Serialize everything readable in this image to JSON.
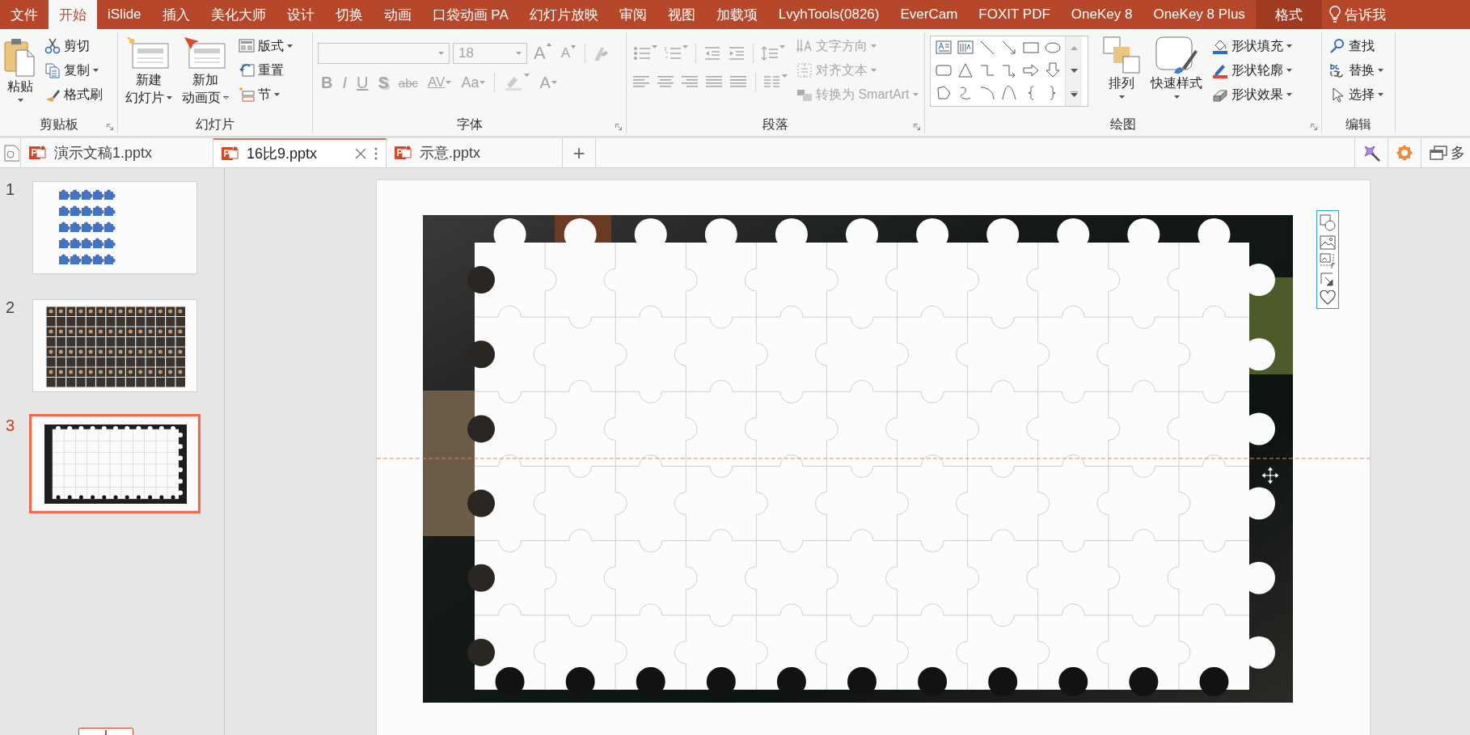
{
  "ribbon_tabs": [
    {
      "label": "文件",
      "selected": false,
      "kind": "normal"
    },
    {
      "label": "开始",
      "selected": true,
      "kind": "normal"
    },
    {
      "label": "iSlide",
      "selected": false,
      "kind": "normal"
    },
    {
      "label": "插入",
      "selected": false,
      "kind": "normal"
    },
    {
      "label": "美化大师",
      "selected": false,
      "kind": "normal"
    },
    {
      "label": "设计",
      "selected": false,
      "kind": "normal"
    },
    {
      "label": "切换",
      "selected": false,
      "kind": "normal"
    },
    {
      "label": "动画",
      "selected": false,
      "kind": "normal"
    },
    {
      "label": "口袋动画 PA",
      "selected": false,
      "kind": "normal"
    },
    {
      "label": "幻灯片放映",
      "selected": false,
      "kind": "normal"
    },
    {
      "label": "审阅",
      "selected": false,
      "kind": "normal"
    },
    {
      "label": "视图",
      "selected": false,
      "kind": "normal"
    },
    {
      "label": "加载项",
      "selected": false,
      "kind": "normal"
    },
    {
      "label": "LvyhTools(0826)",
      "selected": false,
      "kind": "normal"
    },
    {
      "label": "EverCam",
      "selected": false,
      "kind": "normal"
    },
    {
      "label": "FOXIT PDF",
      "selected": false,
      "kind": "normal"
    },
    {
      "label": "OneKey 8",
      "selected": false,
      "kind": "normal"
    },
    {
      "label": "OneKey 8 Plus",
      "selected": false,
      "kind": "normal"
    },
    {
      "label": "格式",
      "selected": false,
      "kind": "contextual"
    }
  ],
  "tell_me": "告诉我",
  "ribbon_groups": [
    {
      "kind": "clipboard",
      "label": "剪贴板",
      "buttons": [
        {
          "label": "粘贴"
        },
        {
          "label": "剪切"
        },
        {
          "label": "复制"
        },
        {
          "label": "格式刷"
        }
      ]
    },
    {
      "kind": "slides",
      "label": "幻灯片",
      "buttons": [
        {
          "lines": [
            "新建",
            "幻灯片"
          ]
        },
        {
          "lines": [
            "新加",
            "动画页"
          ]
        },
        {
          "label": "版式"
        },
        {
          "label": "重置"
        },
        {
          "label": "节"
        }
      ]
    },
    {
      "kind": "font",
      "label": "字体",
      "font_name": {
        "disabled": true
      },
      "font_size": {
        "value": "18",
        "disabled": true
      },
      "size_buttons": [
        {
          "label": "A",
          "disabled": true
        },
        {
          "label": "A",
          "disabled": true
        }
      ],
      "buttons": [
        {
          "label": "B",
          "disabled": true
        },
        {
          "label": "I",
          "disabled": true
        },
        {
          "label": "U",
          "disabled": true
        },
        {
          "label": "S",
          "disabled": true
        },
        {
          "label": "abc",
          "disabled": true
        },
        {
          "label": "AV",
          "disabled": true
        },
        {
          "label": "Aa",
          "disabled": true
        },
        {
          "label": "A",
          "disabled": true
        }
      ]
    },
    {
      "kind": "paragraph",
      "label": "段落",
      "commands": [
        {
          "label": "文字方向",
          "disabled": true
        },
        {
          "label": "对齐文本",
          "disabled": true
        },
        {
          "label": "转换为 SmartArt",
          "disabled": true
        }
      ]
    },
    {
      "kind": "drawing",
      "label": "绘图",
      "buttons": [
        {
          "label": "排列"
        },
        {
          "label": "快速样式"
        },
        {
          "label": "形状填充"
        },
        {
          "label": "形状轮廓"
        },
        {
          "label": "形状效果"
        }
      ]
    },
    {
      "kind": "editing",
      "label": "编辑",
      "buttons": [
        {
          "label": "查找"
        },
        {
          "label": "替换"
        },
        {
          "label": "选择"
        }
      ]
    }
  ],
  "document_tabs": [
    {
      "label": "演示文稿1.pptx",
      "selected": false
    },
    {
      "label": "16比9.pptx",
      "selected": true
    },
    {
      "label": "示意.pptx",
      "selected": false
    }
  ],
  "new_tab": "+",
  "view_menu": "多",
  "slides": [
    {
      "number": "1",
      "kind": "pieces",
      "selected": false
    },
    {
      "number": "2",
      "kind": "mosaic",
      "selected": false
    },
    {
      "number": "3",
      "kind": "frame",
      "selected": true
    }
  ]
}
